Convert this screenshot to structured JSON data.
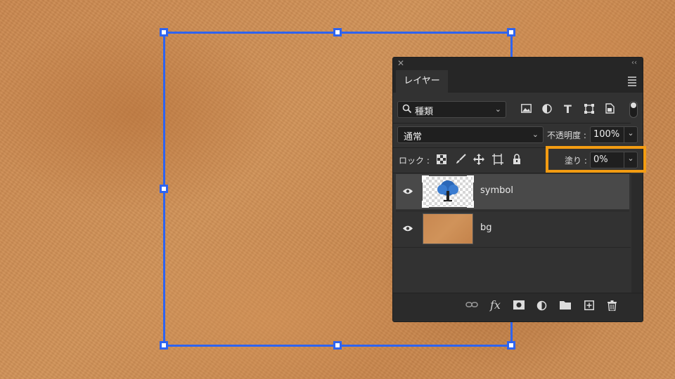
{
  "panel": {
    "tab_label": "レイヤー",
    "filter": {
      "label": "種類"
    },
    "blend_mode": "通常",
    "opacity": {
      "label": "不透明度 :",
      "value": "100%"
    },
    "lock": {
      "label": "ロック :"
    },
    "fill": {
      "label": "塗り :",
      "value": "0%"
    },
    "layers": [
      {
        "name": "symbol",
        "selected": true,
        "visible": true
      },
      {
        "name": "bg",
        "selected": false,
        "visible": true
      }
    ],
    "footer_icons": [
      "link-icon",
      "fx-icon",
      "mask-icon",
      "adjustment-icon",
      "folder-icon",
      "new-layer-icon",
      "trash-icon"
    ],
    "footer_fx": "fx"
  },
  "colors": {
    "transform_box": "#2e64f0",
    "highlight": "#f39c12",
    "panel_bg": "#323232"
  }
}
